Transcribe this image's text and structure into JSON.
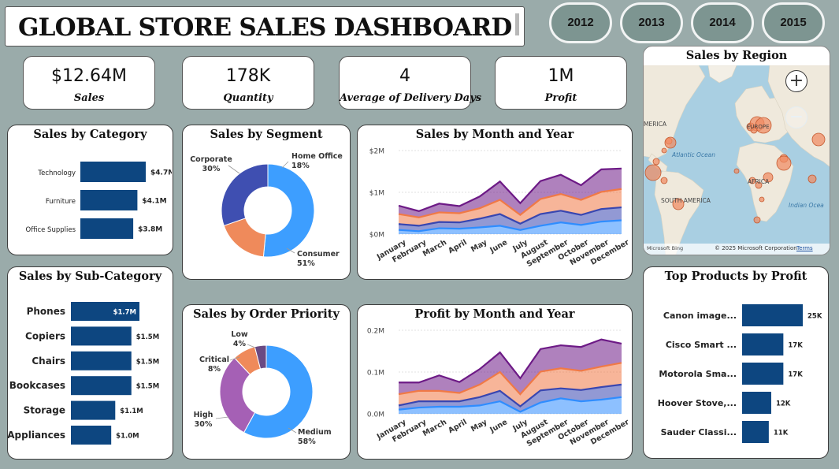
{
  "header": {
    "title": "GLOBAL STORE SALES DASHBOARD"
  },
  "years": [
    "2012",
    "2013",
    "2014",
    "2015"
  ],
  "kpis": [
    {
      "value": "$12.64M",
      "label": "Sales"
    },
    {
      "value": "178K",
      "label": "Quantity"
    },
    {
      "value": "4",
      "label": "Average of Delivery Days"
    },
    {
      "value": "1M",
      "label": "Profit"
    }
  ],
  "colors": {
    "bar": "#0d4680",
    "consumer": "#3d9eff",
    "corporate": "#3f4fb1",
    "home_office": "#ef8a5b",
    "high": "#a560b5",
    "critical": "#ef8a5b",
    "low": "#6a4a83",
    "area_top": "#6d1a86",
    "area_mid": "#f07946",
    "area_low": "#3846b1",
    "area_base": "#2f8dff"
  },
  "category": {
    "title": "Sales by Category",
    "chart_data": {
      "type": "bar",
      "orientation": "horizontal",
      "categories": [
        "Technology",
        "Furniture",
        "Office Supplies"
      ],
      "values": [
        4.7,
        4.1,
        3.8
      ],
      "labels": [
        "$4.7M",
        "$4.1M",
        "$3.8M"
      ],
      "unit": "$M"
    }
  },
  "subcategory": {
    "title": "Sales by Sub-Category",
    "chart_data": {
      "type": "bar",
      "orientation": "horizontal",
      "categories": [
        "Phones",
        "Copiers",
        "Chairs",
        "Bookcases",
        "Storage",
        "Appliances"
      ],
      "values": [
        1.7,
        1.5,
        1.5,
        1.5,
        1.1,
        1.0
      ],
      "labels": [
        "$1.7M",
        "$1.5M",
        "$1.5M",
        "$1.5M",
        "$1.1M",
        "$1.0M"
      ],
      "unit": "$M"
    }
  },
  "segment": {
    "title": "Sales by Segment",
    "chart_data": {
      "type": "pie",
      "donut": true,
      "categories": [
        "Consumer",
        "Home Office",
        "Corporate"
      ],
      "values": [
        51,
        18,
        30
      ],
      "labels": [
        "51%",
        "18%",
        "30%"
      ]
    }
  },
  "priority": {
    "title": "Sales by Order Priority",
    "chart_data": {
      "type": "pie",
      "donut": true,
      "categories": [
        "Medium",
        "High",
        "Critical",
        "Low"
      ],
      "values": [
        58,
        30,
        8,
        4
      ],
      "labels": [
        "58%",
        "30%",
        "8%",
        "4%"
      ]
    }
  },
  "sales_month": {
    "title": "Sales by Month and Year",
    "chart_data": {
      "type": "area",
      "stacked": true,
      "categories": [
        "January",
        "February",
        "March",
        "April",
        "May",
        "June",
        "July",
        "August",
        "September",
        "October",
        "November",
        "December"
      ],
      "yticks": [
        "$0M",
        "$1M",
        "$2M"
      ],
      "ylim": [
        0,
        2
      ],
      "series": [
        {
          "values": [
            0.1,
            0.07,
            0.14,
            0.13,
            0.16,
            0.2,
            0.1,
            0.2,
            0.28,
            0.22,
            0.3,
            0.33
          ]
        },
        {
          "values": [
            0.24,
            0.2,
            0.29,
            0.28,
            0.37,
            0.48,
            0.25,
            0.48,
            0.56,
            0.46,
            0.6,
            0.64
          ]
        },
        {
          "values": [
            0.48,
            0.4,
            0.52,
            0.5,
            0.62,
            0.82,
            0.46,
            0.84,
            0.96,
            0.82,
            1.01,
            1.08
          ]
        },
        {
          "values": [
            0.68,
            0.55,
            0.73,
            0.67,
            0.9,
            1.26,
            0.74,
            1.27,
            1.42,
            1.17,
            1.55,
            1.57
          ]
        }
      ]
    }
  },
  "profit_month": {
    "title": "Profit by Month and Year",
    "chart_data": {
      "type": "area",
      "stacked": true,
      "categories": [
        "January",
        "February",
        "March",
        "April",
        "May",
        "June",
        "July",
        "August",
        "September",
        "October",
        "November",
        "December"
      ],
      "yticks": [
        "0.0M",
        "0.1M",
        "0.2M"
      ],
      "ylim": [
        0,
        0.2
      ],
      "series": [
        {
          "values": [
            0.01,
            0.015,
            0.017,
            0.017,
            0.02,
            0.03,
            0.005,
            0.027,
            0.037,
            0.03,
            0.034,
            0.04
          ]
        },
        {
          "values": [
            0.02,
            0.03,
            0.03,
            0.03,
            0.04,
            0.055,
            0.018,
            0.056,
            0.061,
            0.057,
            0.064,
            0.07
          ]
        },
        {
          "values": [
            0.047,
            0.055,
            0.055,
            0.05,
            0.07,
            0.1,
            0.047,
            0.101,
            0.109,
            0.103,
            0.113,
            0.122
          ]
        },
        {
          "values": [
            0.075,
            0.075,
            0.092,
            0.076,
            0.107,
            0.147,
            0.085,
            0.155,
            0.164,
            0.16,
            0.178,
            0.168
          ]
        }
      ]
    }
  },
  "top_products": {
    "title": "Top Products by Profit",
    "chart_data": {
      "type": "bar",
      "orientation": "horizontal",
      "categories": [
        "Canon image...",
        "Cisco Smart ...",
        "Motorola Sma...",
        "Hoover Stove,...",
        "Sauder Classi..."
      ],
      "values": [
        25,
        17,
        17,
        12,
        11
      ],
      "labels": [
        "25K",
        "17K",
        "17K",
        "12K",
        "11K"
      ],
      "unit": "K"
    }
  },
  "map": {
    "title": "Sales by Region",
    "place_labels": [
      "MERICA",
      "EUROPE",
      "Atlantic Ocean",
      "AFRICA",
      "SOUTH AMERICA",
      "Indian Ocea"
    ],
    "brand": "Microsoft Bing",
    "copyright": "© 2025 Microsoft Corporation",
    "terms": "Terms",
    "zoom_in": "+",
    "zoom_out": "−"
  }
}
